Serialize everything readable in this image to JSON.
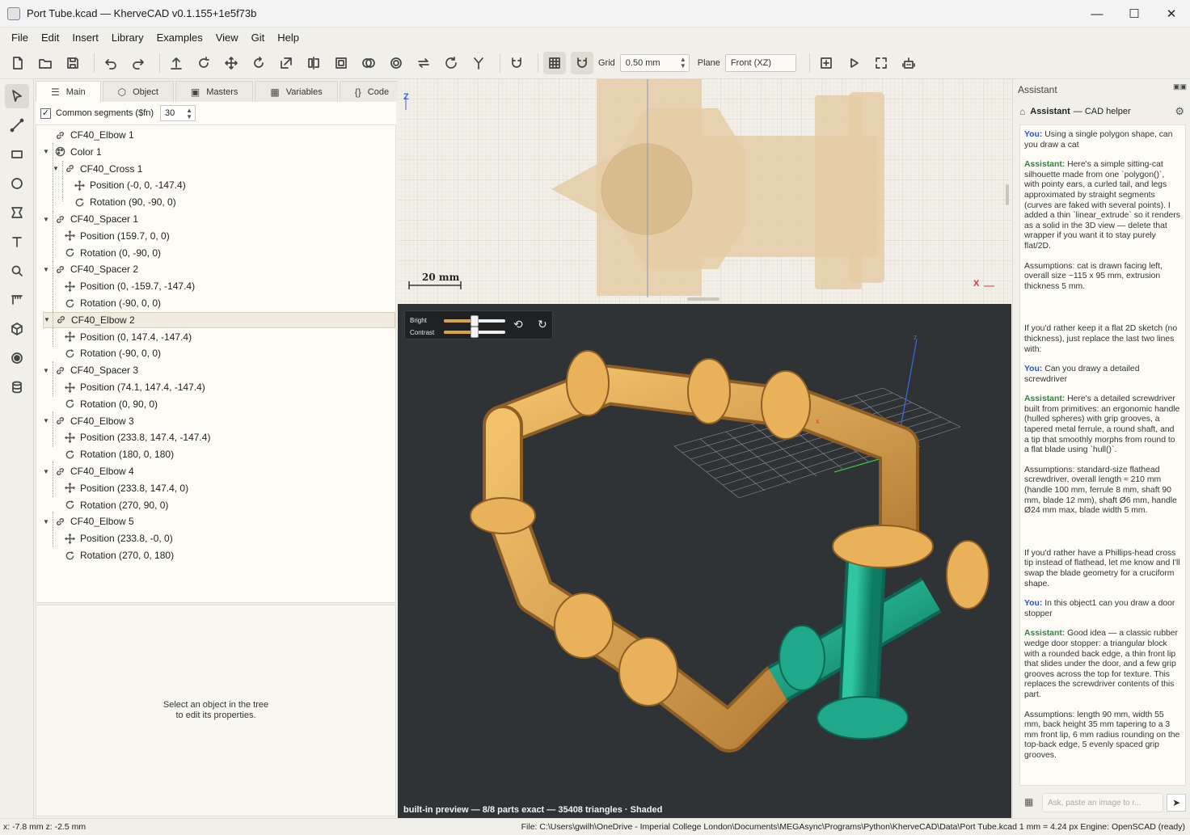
{
  "window": {
    "title": "Port Tube.kcad — KherveCAD v0.1.155+1e5f73b",
    "minimize": "—",
    "maximize": "☐",
    "close": "✕"
  },
  "menu": [
    "File",
    "Edit",
    "Insert",
    "Library",
    "Examples",
    "View",
    "Git",
    "Help"
  ],
  "toolbar": {
    "grid_label": "Grid",
    "grid_value": "0.50 mm",
    "plane_label": "Plane",
    "plane_value": "Front (XZ)"
  },
  "tabs": [
    {
      "label": "Main",
      "icon": "list-icon"
    },
    {
      "label": "Object",
      "icon": "cube-icon"
    },
    {
      "label": "Masters",
      "icon": "image-icon"
    },
    {
      "label": "Variables",
      "icon": "table-icon"
    },
    {
      "label": "Code",
      "icon": "braces-icon"
    }
  ],
  "segments": {
    "label": "Common segments ($fn)",
    "value": "30",
    "checked": true
  },
  "tree": [
    {
      "label": "CF40_Elbow 1",
      "type": "link",
      "level": 0,
      "expandable": false
    },
    {
      "label": "Color 1",
      "type": "palette",
      "level": 0,
      "expandable": true
    },
    {
      "label": "CF40_Cross 1",
      "type": "link",
      "level": 1,
      "expandable": true
    },
    {
      "label": "Position (-0, 0, -147.4)",
      "type": "move",
      "level": 2,
      "expandable": false
    },
    {
      "label": "Rotation (90, -90, 0)",
      "type": "rotate",
      "level": 2,
      "expandable": false
    },
    {
      "label": "CF40_Spacer 1",
      "type": "link",
      "level": 0,
      "expandable": true
    },
    {
      "label": "Position (159.7, 0, 0)",
      "type": "move",
      "level": 1,
      "expandable": false
    },
    {
      "label": "Rotation (0, -90, 0)",
      "type": "rotate",
      "level": 1,
      "expandable": false
    },
    {
      "label": "CF40_Spacer 2",
      "type": "link",
      "level": 0,
      "expandable": true
    },
    {
      "label": "Position (0, -159.7, -147.4)",
      "type": "move",
      "level": 1,
      "expandable": false
    },
    {
      "label": "Rotation (-90, 0, 0)",
      "type": "rotate",
      "level": 1,
      "expandable": false
    },
    {
      "label": "CF40_Elbow 2",
      "type": "link",
      "level": 0,
      "expandable": true,
      "selected": true
    },
    {
      "label": "Position (0, 147.4, -147.4)",
      "type": "move",
      "level": 1,
      "expandable": false
    },
    {
      "label": "Rotation (-90, 0, 0)",
      "type": "rotate",
      "level": 1,
      "expandable": false
    },
    {
      "label": "CF40_Spacer 3",
      "type": "link",
      "level": 0,
      "expandable": true
    },
    {
      "label": "Position (74.1, 147.4, -147.4)",
      "type": "move",
      "level": 1,
      "expandable": false
    },
    {
      "label": "Rotation (0, 90, 0)",
      "type": "rotate",
      "level": 1,
      "expandable": false
    },
    {
      "label": "CF40_Elbow 3",
      "type": "link",
      "level": 0,
      "expandable": true
    },
    {
      "label": "Position (233.8, 147.4, -147.4)",
      "type": "move",
      "level": 1,
      "expandable": false
    },
    {
      "label": "Rotation (180, 0, 180)",
      "type": "rotate",
      "level": 1,
      "expandable": false
    },
    {
      "label": "CF40_Elbow 4",
      "type": "link",
      "level": 0,
      "expandable": true
    },
    {
      "label": "Position (233.8, 147.4, 0)",
      "type": "move",
      "level": 1,
      "expandable": false
    },
    {
      "label": "Rotation (270, 90, 0)",
      "type": "rotate",
      "level": 1,
      "expandable": false
    },
    {
      "label": "CF40_Elbow 5",
      "type": "link",
      "level": 0,
      "expandable": true
    },
    {
      "label": "Position (233.8, -0, 0)",
      "type": "move",
      "level": 1,
      "expandable": false
    },
    {
      "label": "Rotation (270, 0, 180)",
      "type": "rotate",
      "level": 1,
      "expandable": false
    }
  ],
  "properties": {
    "line1": "Select an object in the tree",
    "line2": "to edit its properties."
  },
  "view2d": {
    "z_label": "Z",
    "x_label": "X",
    "scale_label": "20 mm"
  },
  "view3d": {
    "bright_label": "Bright",
    "contrast_label": "Contrast",
    "bright_level": 0.5,
    "contrast_level": 0.5,
    "status": "built-in preview — 8/8 parts exact — 35408 triangles · Shaded",
    "axis_z": "z",
    "axis_x": "x"
  },
  "assistant": {
    "panel_title": "Assistant",
    "name": "Assistant",
    "subtitle": "— CAD helper",
    "you_label": "You:",
    "assistant_label": "Assistant:",
    "messages": [
      {
        "role": "you",
        "text": "Using a single polygon shape, can you draw a cat"
      },
      {
        "role": "assistant",
        "text": "Here's a simple sitting-cat silhouette made from one `polygon()`, with pointy ears, a curled tail, and legs approximated by straight segments (curves are faked with several points). I added a thin `linear_extrude` so it renders as a solid in the 3D view — delete that wrapper if you want it to stay purely flat/2D."
      },
      {
        "role": "plain",
        "text": "Assumptions: cat is drawn facing left, overall size ~115 x 95 mm, extrusion thickness 5 mm.",
        "gap": true
      },
      {
        "role": "plain",
        "text": "If you'd rather keep it a flat 2D sketch (no thickness), just replace the last two lines with:"
      },
      {
        "role": "you",
        "text": "Can you drawy a detailed screwdriver"
      },
      {
        "role": "assistant",
        "text": "Here's a detailed screwdriver built from primitives: an ergonomic handle (hulled spheres) with grip grooves, a tapered metal ferrule, a round shaft, and a tip that smoothly morphs from round to a flat blade using `hull()`."
      },
      {
        "role": "plain",
        "text": "Assumptions: standard-size flathead screwdriver, overall length ≈ 210 mm (handle 100 mm, ferrule 8 mm, shaft 90 mm, blade 12 mm), shaft Ø6 mm, handle Ø24 mm max, blade width 5 mm.",
        "gap": true
      },
      {
        "role": "plain",
        "text": "If you'd rather have a Phillips-head cross tip instead of flathead, let me know and I'll swap the blade geometry for a cruciform shape."
      },
      {
        "role": "you",
        "text": "In this object1 can you draw a door stopper"
      },
      {
        "role": "assistant",
        "text": "Good idea — a classic rubber wedge door stopper: a triangular block with a rounded back edge, a thin front lip that slides under the door, and a few grip grooves across the top for texture. This replaces the screwdriver contents of this part."
      },
      {
        "role": "plain",
        "text": "Assumptions: length 90 mm, width 55 mm, back height 35 mm tapering to a 3 mm front lip, 6 mm radius rounding on the top-back edge, 5 evenly spaced grip grooves."
      }
    ],
    "input_placeholder": "Ask, paste an image to r..."
  },
  "statusbar": {
    "coords": "x: -7.8 mm  z: -2.5 mm",
    "file": "File: C:\\Users\\gwilh\\OneDrive - Imperial College London\\Documents\\MEGAsync\\Programs\\Python\\KherveCAD\\Data\\Port Tube.kcad  1 mm = 4.24 px  Engine: OpenSCAD (ready)"
  },
  "colors": {
    "pipe": "#e2a94c",
    "cross": "#1fa98a",
    "accent": "#d9a441",
    "viewport3d": "#303336"
  }
}
